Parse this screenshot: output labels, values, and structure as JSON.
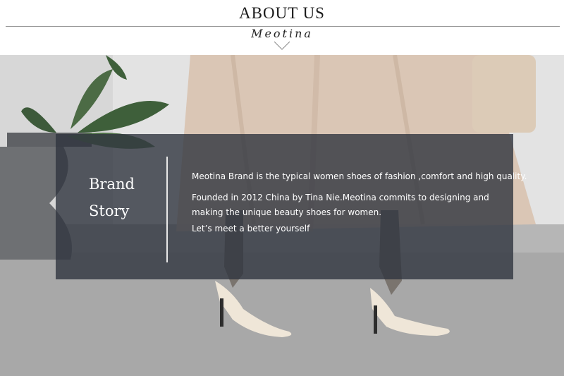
{
  "header": {
    "title": "ABOUT US",
    "logo_text": "Meotina",
    "chevron_icon": "chevron-down-icon"
  },
  "story": {
    "heading_line1": "Brand",
    "heading_line2": "Story",
    "paragraph1": "Meotina Brand is the typical women shoes of fashion ,comfort and high quality.",
    "paragraph2": "Founded in 2012 China by Tina Nie.Meotina commits to designing and making the unique beauty shoes for women.",
    "paragraph3": "Let’s meet a better yourself"
  },
  "colors": {
    "overlay": "#30343f",
    "text": "#ffffff",
    "header_background": "#ffffff"
  }
}
